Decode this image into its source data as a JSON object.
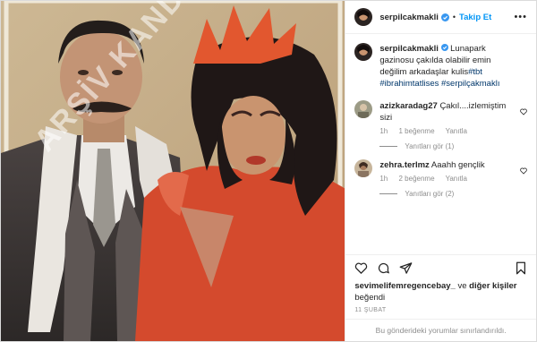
{
  "post": {
    "username": "serpilcakmakli",
    "follow_label": "Takip Et",
    "caption_username": "serpilcakmakli",
    "caption_text": "Lunapark gazinosu çakılda olabilir emin değilim arkadaşlar kulis",
    "hashtags": [
      "#tbt",
      "#ibrahimtatlises",
      "#serpilçakmaklı"
    ],
    "watermark": "ARŞİV KANDEMİR",
    "comments": [
      {
        "username": "azizkaradag27",
        "text": "Çakıl....izlemiştim sizi",
        "time": "1h",
        "likes": "1 beğenme",
        "reply": "Yanıtla",
        "replies_label": "Yanıtları gör (1)"
      },
      {
        "username": "zehra.terlmz",
        "text": "Aaahh gençlik",
        "time": "1h",
        "likes": "2 beğenme",
        "reply": "Yanıtla",
        "replies_label": "Yanıtları gör (2)"
      }
    ],
    "liked_by_user": "sevimelifemregencebay_",
    "liked_by_rest": "ve diğer kişiler beğendi",
    "liked_and": "ve",
    "liked_others": "diğer kişiler",
    "liked_suffix": "beğendi",
    "date": "11 ŞUBAT",
    "comments_closed": "Bu gönderideki yorumlar sınırlandırıldı."
  }
}
